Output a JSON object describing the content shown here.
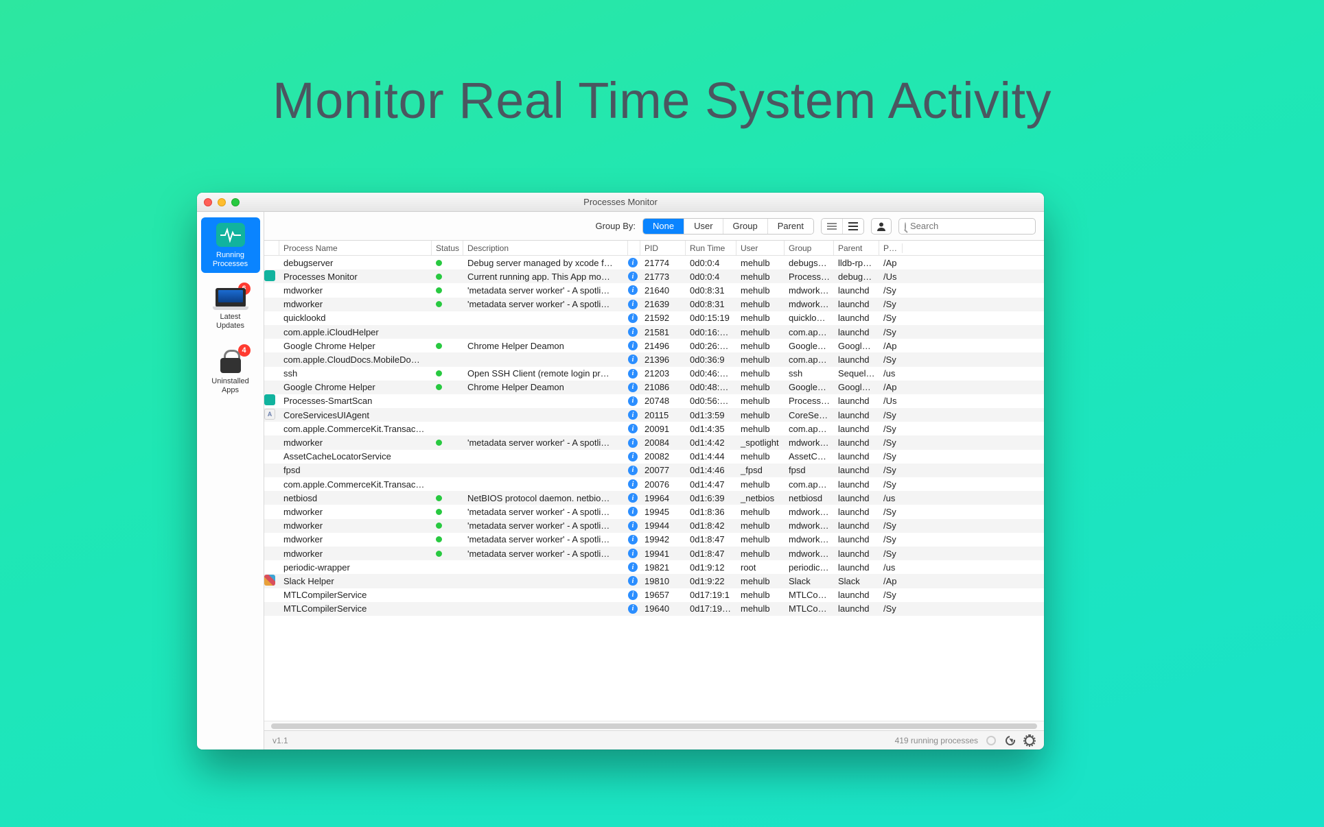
{
  "hero": "Monitor Real Time System Activity",
  "window": {
    "title": "Processes Monitor",
    "version": "v1.1",
    "status_text": "419 running processes"
  },
  "sidebar": {
    "items": [
      {
        "label": "Running\nProcesses",
        "active": true
      },
      {
        "label": "Latest\nUpdates",
        "badge": "6"
      },
      {
        "label": "Uninstalled\nApps",
        "badge": "4"
      }
    ]
  },
  "toolbar": {
    "group_by_label": "Group By:",
    "options": [
      "None",
      "User",
      "Group",
      "Parent"
    ],
    "search_placeholder": "Search"
  },
  "columns": [
    "Process Name",
    "Status",
    "Description",
    "PID",
    "Run Time",
    "User",
    "Group",
    "Parent",
    "Path"
  ],
  "rows": [
    {
      "icon": "",
      "name": "debugserver",
      "status": true,
      "desc": "Debug server managed by xcode f…",
      "pid": "21774",
      "run": "0d0:0:4",
      "user": "mehulb",
      "group": "debugs…",
      "parent": "lldb-rpc…",
      "path": "/Ap"
    },
    {
      "icon": "teal",
      "name": "Processes Monitor",
      "status": true,
      "desc": "Current running app. This App mo…",
      "pid": "21773",
      "run": "0d0:0:4",
      "user": "mehulb",
      "group": "Process…",
      "parent": "debugs…",
      "path": "/Us"
    },
    {
      "icon": "",
      "name": "mdworker",
      "status": true,
      "desc": "'metadata server worker' - A spotli…",
      "pid": "21640",
      "run": "0d0:8:31",
      "user": "mehulb",
      "group": "mdwork…",
      "parent": "launchd",
      "path": "/Sy"
    },
    {
      "icon": "",
      "name": "mdworker",
      "status": true,
      "desc": "'metadata server worker' - A spotli…",
      "pid": "21639",
      "run": "0d0:8:31",
      "user": "mehulb",
      "group": "mdwork…",
      "parent": "launchd",
      "path": "/Sy"
    },
    {
      "icon": "",
      "name": "quicklookd",
      "status": false,
      "desc": "",
      "pid": "21592",
      "run": "0d0:15:19",
      "user": "mehulb",
      "group": "quicklo…",
      "parent": "launchd",
      "path": "/Sy"
    },
    {
      "icon": "",
      "name": "com.apple.iCloudHelper",
      "status": false,
      "desc": "",
      "pid": "21581",
      "run": "0d0:16:…",
      "user": "mehulb",
      "group": "com.ap…",
      "parent": "launchd",
      "path": "/Sy"
    },
    {
      "icon": "",
      "name": "Google Chrome Helper",
      "status": true,
      "desc": "Chrome Helper Deamon",
      "pid": "21496",
      "run": "0d0:26:…",
      "user": "mehulb",
      "group": "Google…",
      "parent": "Google…",
      "path": "/Ap"
    },
    {
      "icon": "",
      "name": "com.apple.CloudDocs.MobileDo…",
      "status": false,
      "desc": "",
      "pid": "21396",
      "run": "0d0:36:9",
      "user": "mehulb",
      "group": "com.ap…",
      "parent": "launchd",
      "path": "/Sy"
    },
    {
      "icon": "",
      "name": "ssh",
      "status": true,
      "desc": "Open SSH Client (remote login pr…",
      "pid": "21203",
      "run": "0d0:46:…",
      "user": "mehulb",
      "group": "ssh",
      "parent": "Sequel…",
      "path": "/us"
    },
    {
      "icon": "",
      "name": "Google Chrome Helper",
      "status": true,
      "desc": "Chrome Helper Deamon",
      "pid": "21086",
      "run": "0d0:48:…",
      "user": "mehulb",
      "group": "Google…",
      "parent": "Google…",
      "path": "/Ap"
    },
    {
      "icon": "teal",
      "name": "Processes-SmartScan",
      "status": false,
      "desc": "",
      "pid": "20748",
      "run": "0d0:56:…",
      "user": "mehulb",
      "group": "Process…",
      "parent": "launchd",
      "path": "/Us"
    },
    {
      "icon": "doc",
      "name": "CoreServicesUIAgent",
      "status": false,
      "desc": "",
      "pid": "20115",
      "run": "0d1:3:59",
      "user": "mehulb",
      "group": "CoreSer…",
      "parent": "launchd",
      "path": "/Sy"
    },
    {
      "icon": "",
      "name": "com.apple.CommerceKit.Transac…",
      "status": false,
      "desc": "",
      "pid": "20091",
      "run": "0d1:4:35",
      "user": "mehulb",
      "group": "com.ap…",
      "parent": "launchd",
      "path": "/Sy"
    },
    {
      "icon": "",
      "name": "mdworker",
      "status": true,
      "desc": "'metadata server worker' - A spotli…",
      "pid": "20084",
      "run": "0d1:4:42",
      "user": "_spotlight",
      "group": "mdwork…",
      "parent": "launchd",
      "path": "/Sy"
    },
    {
      "icon": "",
      "name": "AssetCacheLocatorService",
      "status": false,
      "desc": "",
      "pid": "20082",
      "run": "0d1:4:44",
      "user": "mehulb",
      "group": "AssetC…",
      "parent": "launchd",
      "path": "/Sy"
    },
    {
      "icon": "",
      "name": "fpsd",
      "status": false,
      "desc": "",
      "pid": "20077",
      "run": "0d1:4:46",
      "user": "_fpsd",
      "group": "fpsd",
      "parent": "launchd",
      "path": "/Sy"
    },
    {
      "icon": "",
      "name": "com.apple.CommerceKit.Transac…",
      "status": false,
      "desc": "",
      "pid": "20076",
      "run": "0d1:4:47",
      "user": "mehulb",
      "group": "com.ap…",
      "parent": "launchd",
      "path": "/Sy"
    },
    {
      "icon": "",
      "name": "netbiosd",
      "status": true,
      "desc": "NetBIOS protocol daemon. netbio…",
      "pid": "19964",
      "run": "0d1:6:39",
      "user": "_netbios",
      "group": "netbiosd",
      "parent": "launchd",
      "path": "/us"
    },
    {
      "icon": "",
      "name": "mdworker",
      "status": true,
      "desc": "'metadata server worker' - A spotli…",
      "pid": "19945",
      "run": "0d1:8:36",
      "user": "mehulb",
      "group": "mdwork…",
      "parent": "launchd",
      "path": "/Sy"
    },
    {
      "icon": "",
      "name": "mdworker",
      "status": true,
      "desc": "'metadata server worker' - A spotli…",
      "pid": "19944",
      "run": "0d1:8:42",
      "user": "mehulb",
      "group": "mdwork…",
      "parent": "launchd",
      "path": "/Sy"
    },
    {
      "icon": "",
      "name": "mdworker",
      "status": true,
      "desc": "'metadata server worker' - A spotli…",
      "pid": "19942",
      "run": "0d1:8:47",
      "user": "mehulb",
      "group": "mdwork…",
      "parent": "launchd",
      "path": "/Sy"
    },
    {
      "icon": "",
      "name": "mdworker",
      "status": true,
      "desc": "'metadata server worker' - A spotli…",
      "pid": "19941",
      "run": "0d1:8:47",
      "user": "mehulb",
      "group": "mdwork…",
      "parent": "launchd",
      "path": "/Sy"
    },
    {
      "icon": "",
      "name": "periodic-wrapper",
      "status": false,
      "desc": "",
      "pid": "19821",
      "run": "0d1:9:12",
      "user": "root",
      "group": "periodic…",
      "parent": "launchd",
      "path": "/us"
    },
    {
      "icon": "slack",
      "name": "Slack Helper",
      "status": false,
      "desc": "",
      "pid": "19810",
      "run": "0d1:9:22",
      "user": "mehulb",
      "group": "Slack",
      "parent": "Slack",
      "path": "/Ap"
    },
    {
      "icon": "",
      "name": "MTLCompilerService",
      "status": false,
      "desc": "",
      "pid": "19657",
      "run": "0d17:19:1",
      "user": "mehulb",
      "group": "MTLCo…",
      "parent": "launchd",
      "path": "/Sy"
    },
    {
      "icon": "",
      "name": "MTLCompilerService",
      "status": false,
      "desc": "",
      "pid": "19640",
      "run": "0d17:19:…",
      "user": "mehulb",
      "group": "MTLCo…",
      "parent": "launchd",
      "path": "/Sy"
    }
  ]
}
